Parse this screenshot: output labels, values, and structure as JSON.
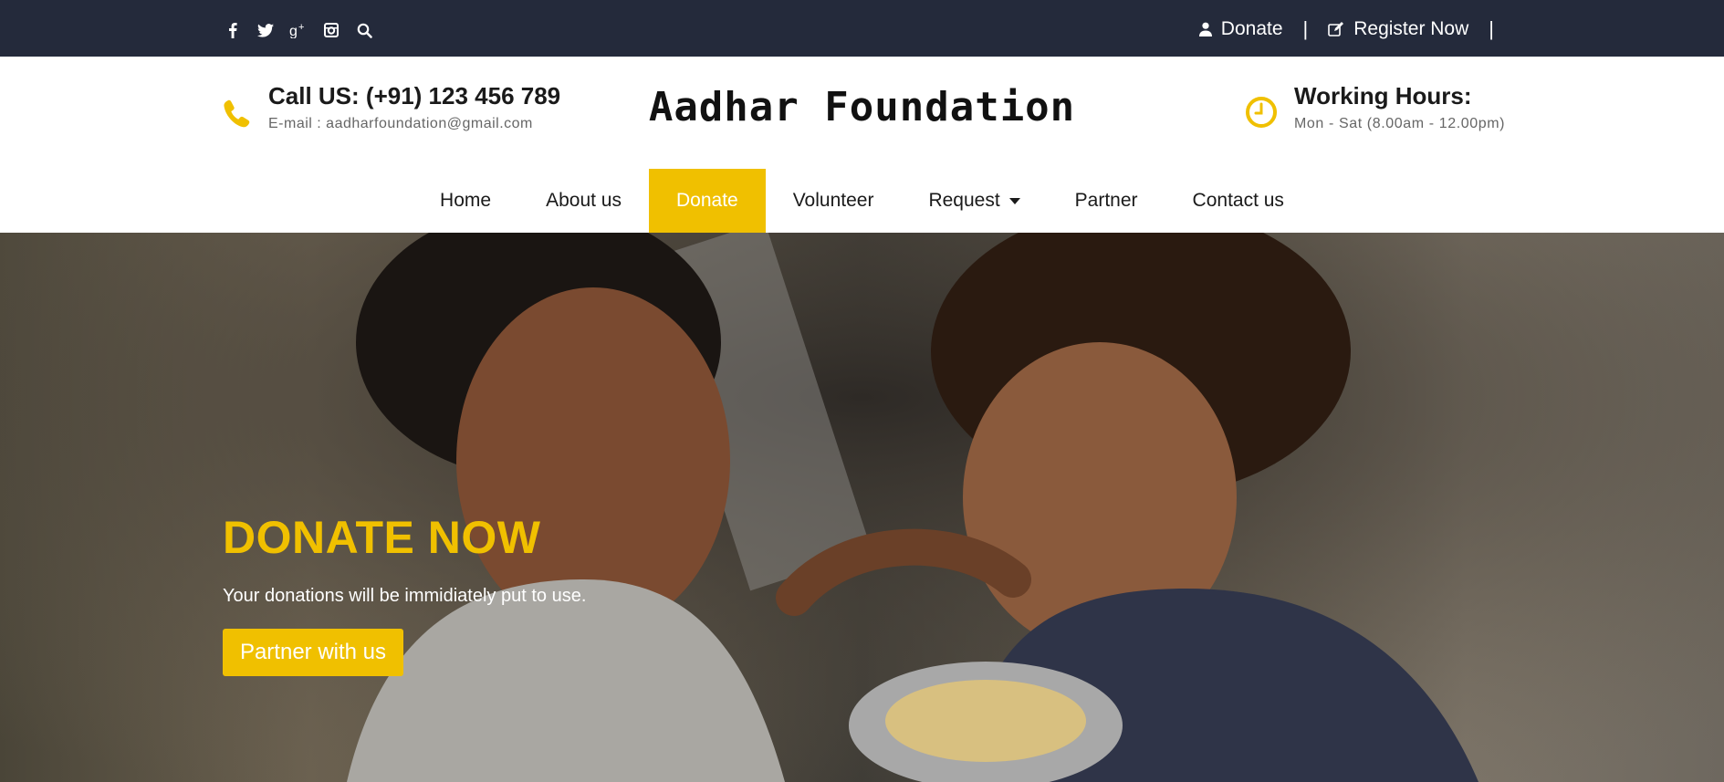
{
  "topbar": {
    "social_icons": [
      "facebook-icon",
      "twitter-icon",
      "google-plus-icon",
      "instagram-icon",
      "search-icon"
    ],
    "donate_label": "Donate",
    "register_label": "Register Now",
    "separator": "|"
  },
  "header": {
    "call": "Call US: (+91) 123 456 789",
    "email": "E-mail : aadharfoundation@gmail.com",
    "brand": "Aadhar Foundation",
    "hours_title": "Working Hours:",
    "hours_text": "Mon - Sat (8.00am - 12.00pm)"
  },
  "nav": {
    "items": [
      "Home",
      "About us",
      "Donate",
      "Volunteer",
      "Request",
      "Partner",
      "Contact us"
    ],
    "active": "Donate"
  },
  "hero": {
    "title": "DONATE NOW",
    "subtitle": "Your donations will be immidiately put to use.",
    "button": "Partner with us"
  },
  "colors": {
    "accent": "#f0c000",
    "topbar": "#242a3b"
  }
}
